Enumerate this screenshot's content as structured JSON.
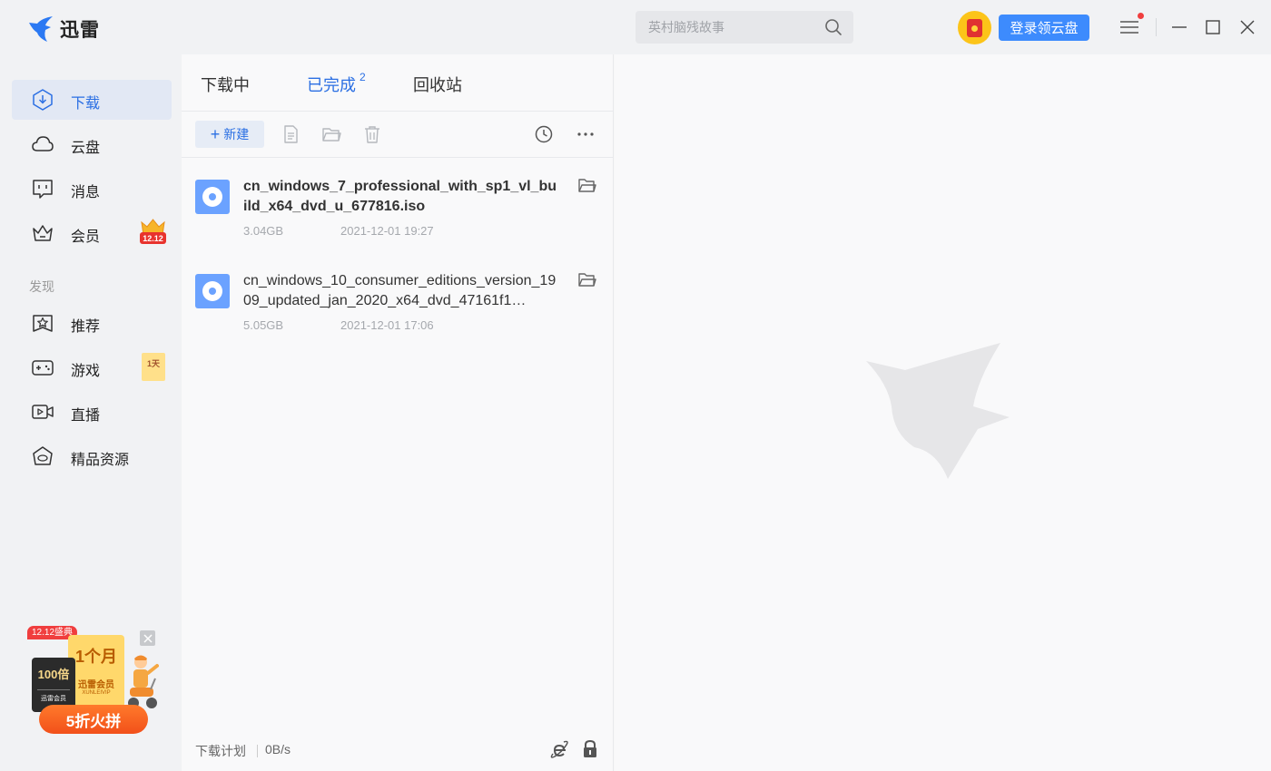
{
  "titlebar": {
    "app_name": "迅雷",
    "search_placeholder": "英村脑残故事",
    "login_button": "登录领云盘"
  },
  "sidebar": {
    "items": [
      {
        "label": "下载",
        "icon": "download-icon",
        "active": true
      },
      {
        "label": "云盘",
        "icon": "cloud-icon"
      },
      {
        "label": "消息",
        "icon": "message-icon"
      },
      {
        "label": "会员",
        "icon": "crown-icon",
        "badge": "12.12"
      }
    ],
    "section": "发现",
    "discover": [
      {
        "label": "推荐",
        "icon": "star-icon"
      },
      {
        "label": "游戏",
        "icon": "gamepad-icon",
        "badge": "1天"
      },
      {
        "label": "直播",
        "icon": "live-video-icon"
      },
      {
        "label": "精品资源",
        "icon": "gem-icon"
      }
    ],
    "promo": {
      "tag": "12.12盛典",
      "card_dark_big": "100倍",
      "card_dark_small": "迅雷会员",
      "card_gold_big": "1个月",
      "card_gold_mid": "迅雷会员",
      "card_gold_tiny": "XUNLEIVIP",
      "button": "5折火拼"
    }
  },
  "tabs": [
    {
      "label": "下载中"
    },
    {
      "label": "已完成",
      "count": "2",
      "active": true
    },
    {
      "label": "回收站"
    }
  ],
  "toolbar": {
    "new_label": "新建"
  },
  "files": [
    {
      "name": "cn_windows_7_professional_with_sp1_vl_build_x64_dvd_u_677816.iso",
      "size": "3.04GB",
      "date": "2021-12-01 19:27"
    },
    {
      "name": "cn_windows_10_consumer_editions_version_1909_updated_jan_2020_x64_dvd_47161f1…",
      "size": "5.05GB",
      "date": "2021-12-01 17:06"
    }
  ],
  "status": {
    "plan": "下载计划",
    "speed": "0B/s"
  },
  "colors": {
    "accent": "#2b6fe3",
    "login": "#3d8bfd",
    "file_icon": "#6ba2ff",
    "promo_button": "#f2501a"
  }
}
